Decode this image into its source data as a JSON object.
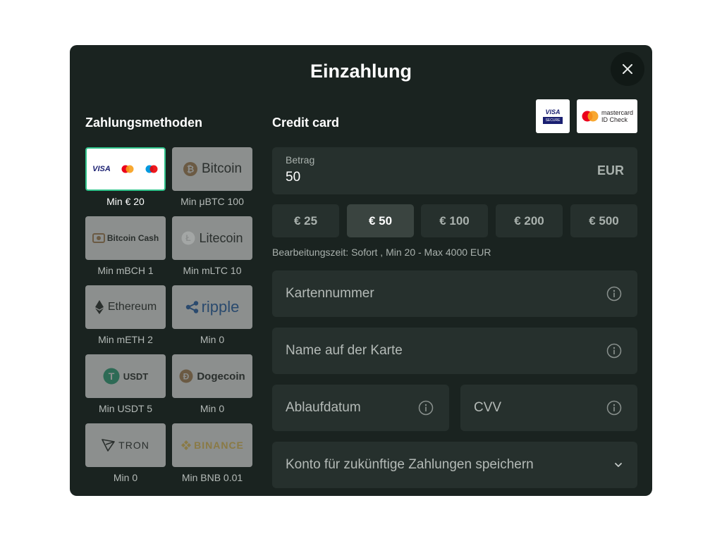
{
  "modal": {
    "title": "Einzahlung"
  },
  "methods": {
    "title": "Zahlungsmethoden",
    "items": [
      {
        "name": "Visa/Mastercard/Maestro",
        "min": "Min € 20"
      },
      {
        "name": "Bitcoin",
        "min": "Min μBTC 100"
      },
      {
        "name": "Bitcoin Cash",
        "min": "Min mBCH 1"
      },
      {
        "name": "Litecoin",
        "min": "Min mLTC 10"
      },
      {
        "name": "Ethereum",
        "min": "Min mETH 2"
      },
      {
        "name": "ripple",
        "min": "Min 0"
      },
      {
        "name": "USDT",
        "min": "Min USDT 5"
      },
      {
        "name": "Dogecoin",
        "min": "Min 0"
      },
      {
        "name": "TRON",
        "min": "Min 0"
      },
      {
        "name": "BINANCE",
        "min": "Min BNB 0.01"
      }
    ]
  },
  "card": {
    "title": "Credit card",
    "visa_logo": "VISA",
    "visa_secure": "SECURE",
    "mc_logo_line1": "mastercard",
    "mc_logo_line2": "ID Check"
  },
  "amount": {
    "label": "Betrag",
    "value": "50",
    "currency": "EUR"
  },
  "chips": [
    "€ 25",
    "€ 50",
    "€ 100",
    "€ 200",
    "€ 500"
  ],
  "processing": "Bearbeitungszeit: Sofort , Min 20 - Max 4000 EUR",
  "fields": {
    "card_number": "Kartennummer",
    "card_name": "Name auf der Karte",
    "expiry": "Ablaufdatum",
    "cvv": "CVV",
    "save_account": "Konto für zukünftige Zahlungen speichern"
  },
  "colors": {
    "background": "#1a2320",
    "field": "#26302d",
    "accent": "#2fc28a"
  }
}
